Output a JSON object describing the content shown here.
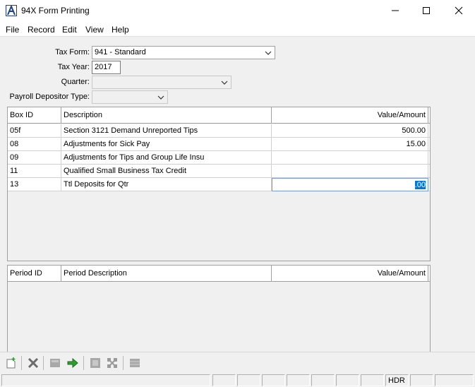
{
  "window": {
    "title": "94X Form Printing"
  },
  "menu": [
    "File",
    "Record",
    "Edit",
    "View",
    "Help"
  ],
  "form": {
    "tax_form_label": "Tax Form:",
    "tax_form_value": "941 - Standard",
    "tax_year_label": "Tax Year:",
    "tax_year_value": "2017",
    "quarter_label": "Quarter:",
    "quarter_value": "",
    "depositor_label": "Payroll Depositor Type:",
    "depositor_value": ""
  },
  "box_grid": {
    "headers": {
      "id": "Box ID",
      "description": "Description",
      "value": "Value/Amount"
    },
    "rows": [
      {
        "id": "05f",
        "description": "Section 3121 Demand Unreported Tips",
        "value": "500.00"
      },
      {
        "id": "08",
        "description": "Adjustments for Sick Pay",
        "value": "15.00"
      },
      {
        "id": "09",
        "description": "Adjustments for Tips and Group Life Insu",
        "value": ""
      },
      {
        "id": "11",
        "description": "Qualified Small Business Tax Credit",
        "value": ""
      },
      {
        "id": "13",
        "description": "Ttl Deposits for Qtr",
        "value": ".00"
      }
    ]
  },
  "period_grid": {
    "headers": {
      "id": "Period ID",
      "description": "Period Description",
      "value": "Value/Amount"
    }
  },
  "statusbar": {
    "hdr": "HDR"
  },
  "colors": {
    "selection": "#0078d7",
    "accent_green": "#2e9e2e",
    "delete_gray": "#6b6b6b"
  }
}
